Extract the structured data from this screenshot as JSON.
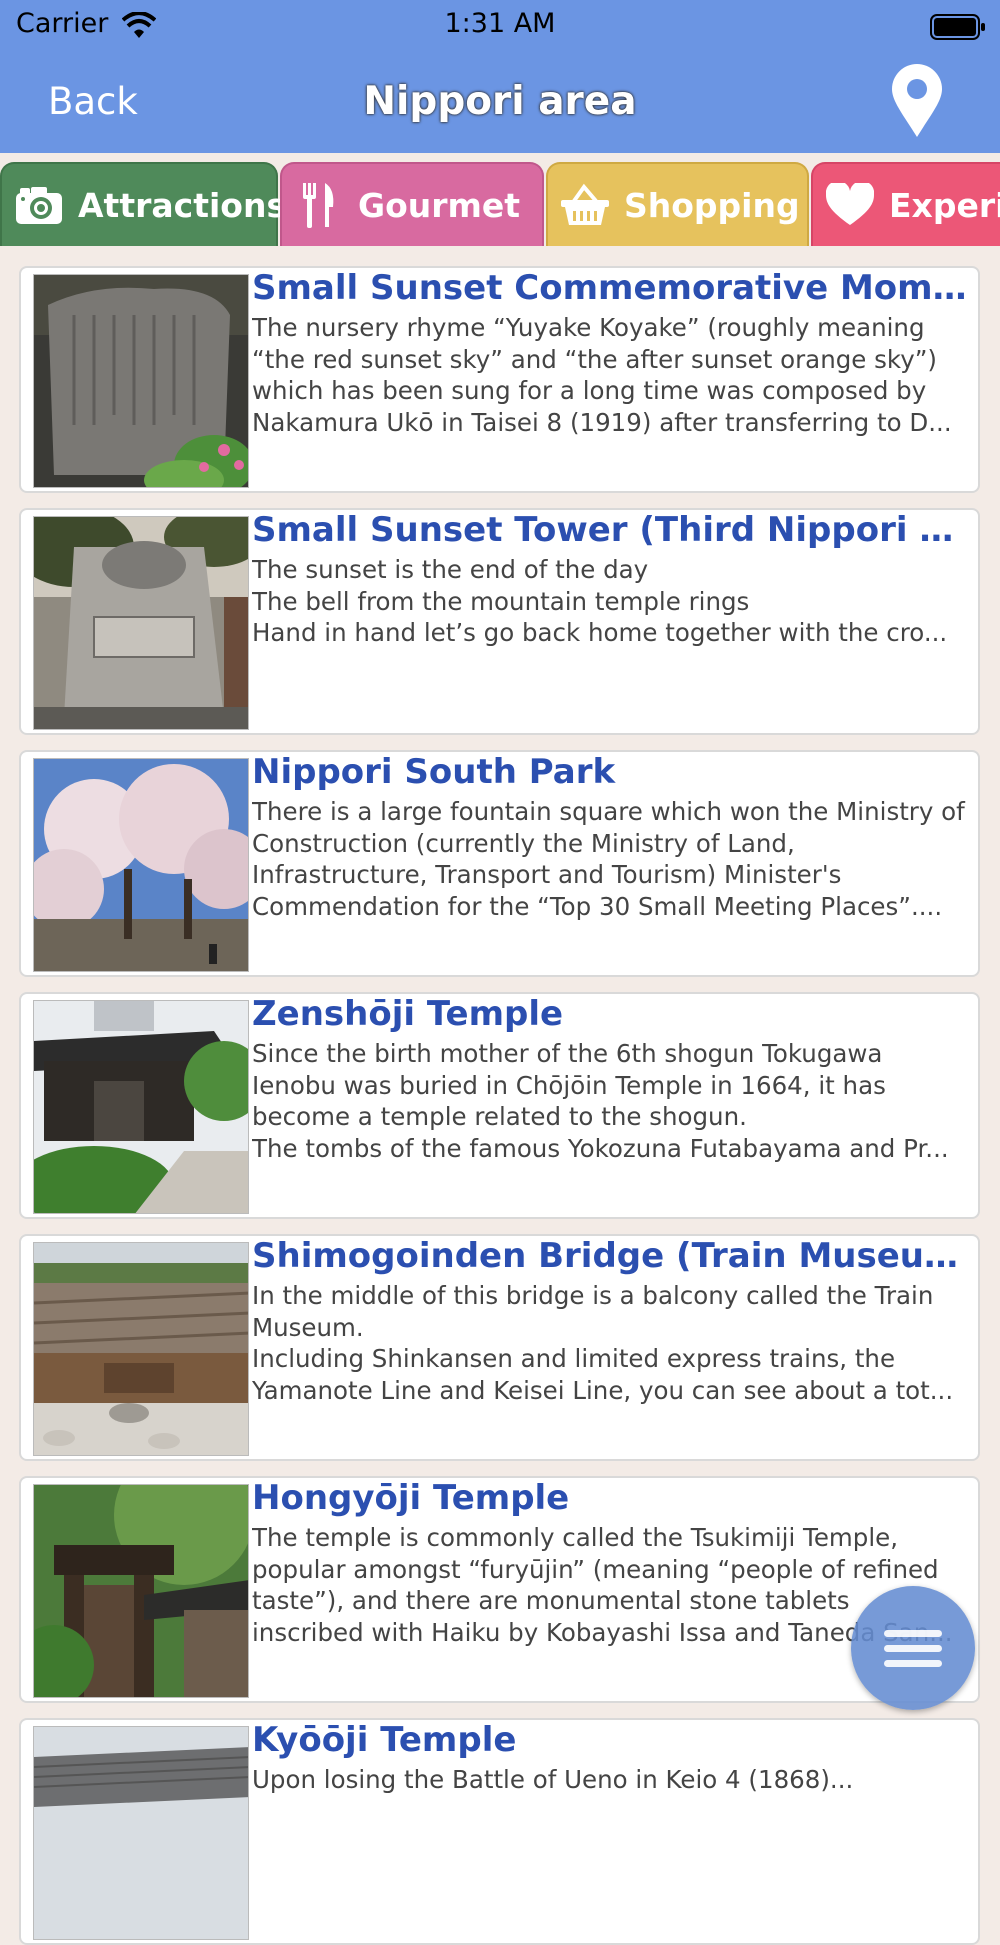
{
  "status": {
    "carrier": "Carrier",
    "time": "1:31 AM"
  },
  "nav": {
    "back_label": "Back",
    "title": "Nippori area",
    "location_icon": "map-pin-icon"
  },
  "tabs": [
    {
      "label": "Attractions",
      "icon": "camera-icon",
      "color": "#4f8a5a"
    },
    {
      "label": "Gourmet",
      "icon": "fork-knife-icon",
      "color": "#d86aa0"
    },
    {
      "label": "Shopping",
      "icon": "basket-icon",
      "color": "#e6c25d"
    },
    {
      "label": "Experie",
      "icon": "heart-icon",
      "color": "#ec5777"
    }
  ],
  "items": [
    {
      "title": "Small Sunset Commemorative Momume...",
      "description": "The nursery rhyme “Yuyake Koyake” (roughly meaning “the red sunset sky” and “the after sunset orange sky”) which has been sung for a long time was composed by Nakamura Ukō in Taisei 8 (1919) after transferring to D..."
    },
    {
      "title": "Small Sunset Tower (Third Nippori Elem...",
      "description": "The sunset is the end of the day\nThe bell from the mountain temple rings\nHand in hand let’s go back home together with the cro..."
    },
    {
      "title": "Nippori South Park",
      "description": "There is a large fountain square which won the Ministry of Construction (currently the Ministry of Land, Infrastructure, Transport and Tourism) Minister's Commendation for the “Top 30 Small Meeting Places”...."
    },
    {
      "title": "Zenshōji Temple",
      "description": "Since the birth mother of the 6th shogun Tokugawa Ienobu was buried in Chōjōin Temple in 1664, it has become a temple related to the shogun.\nThe tombs of the famous Yokozuna Futabayama and Pr..."
    },
    {
      "title": "Shimogoinden Bridge (Train Museum)",
      "description": "In the middle of this bridge is a balcony called the Train Museum.\nIncluding Shinkansen and limited express trains, the Yamanote Line and Keisei Line, you can see about a tot..."
    },
    {
      "title": "Hongyōji Temple",
      "description": "The temple is commonly called the Tsukimiji Temple, popular amongst “furyūjin” (meaning “people of refined taste”), and there are monumental stone tablets inscribed with Haiku by Kobayashi Issa and Taneda San..."
    },
    {
      "title": "Kyōōji Temple",
      "description": "Upon losing the Battle of Ueno in Keio 4 (1868)..."
    }
  ],
  "fab": {
    "icon": "hamburger-menu-icon"
  }
}
